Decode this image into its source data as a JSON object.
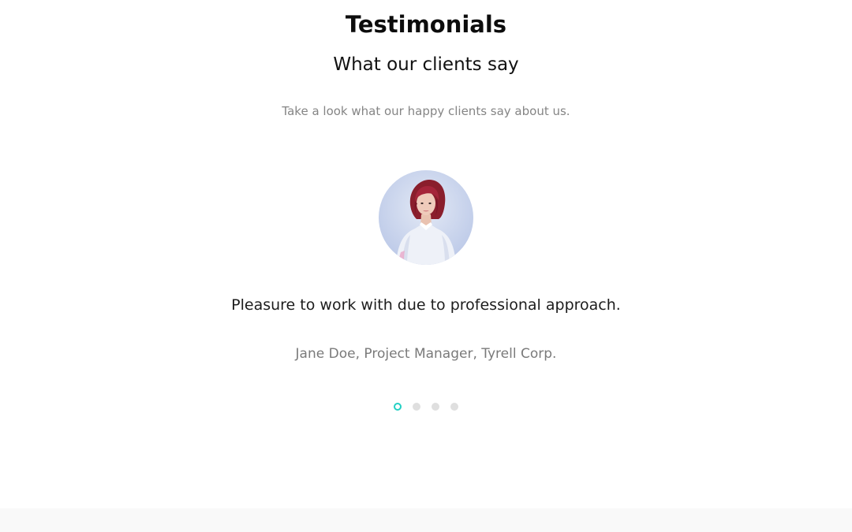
{
  "section": {
    "title": "Testimonials",
    "subtitle": "What our clients say",
    "lead": "Take a look what our happy clients say about us."
  },
  "testimonial": {
    "avatar_alt": "Jane Doe",
    "quote": "Pleasure to work with due to professional approach.",
    "author": "Jane Doe, Project Manager, Tyrell Corp."
  },
  "carousel": {
    "slides_count": 4,
    "active_index": 0,
    "active_color": "#24d0c4",
    "inactive_color": "#dfdfdf"
  },
  "colors": {
    "title": "#0c0c0c",
    "lead": "#858585",
    "author": "#7a7a7a",
    "footer_band": "#f9f9f9"
  }
}
